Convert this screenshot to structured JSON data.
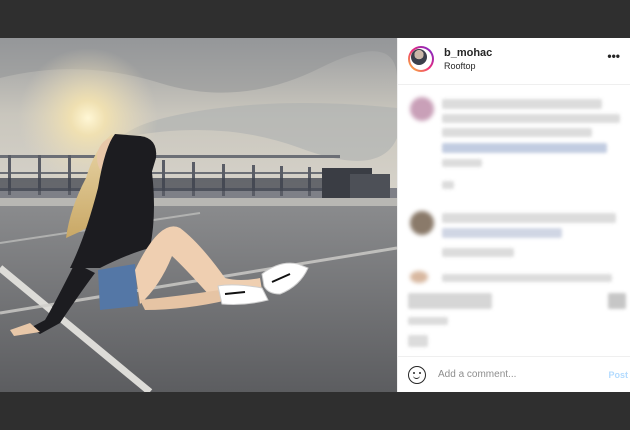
{
  "post": {
    "username": "b_mohac",
    "location": "Rooftop",
    "more_icon": "more-horizontal-icon",
    "more_glyph": "•••"
  },
  "comment_box": {
    "placeholder": "Add a comment...",
    "post_label": "Post",
    "emoji_icon": "smile-icon"
  },
  "colors": {
    "post_button_disabled": "#b3dbff",
    "text": "#262626",
    "muted": "#8e8e8e",
    "backdrop": "#2f2f2f"
  }
}
